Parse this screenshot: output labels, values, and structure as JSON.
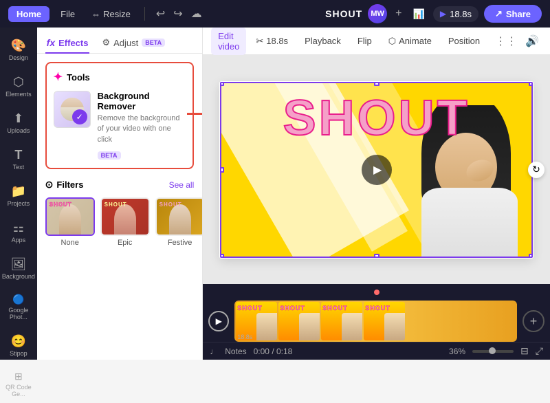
{
  "app": {
    "title": "SHOUT",
    "tab_home": "Home",
    "tab_file": "File",
    "tab_resize": "Resize",
    "share_label": "Share",
    "avatar_initials": "MW",
    "time": "18.8s"
  },
  "toolbar": {
    "edit_video": "Edit video",
    "cut_time": "18.8s",
    "playback": "Playback",
    "flip": "Flip",
    "animate": "Animate",
    "position": "Position"
  },
  "sidebar": {
    "items": [
      {
        "label": "Design",
        "icon": "🎨"
      },
      {
        "label": "Elements",
        "icon": "⬡"
      },
      {
        "label": "Uploads",
        "icon": "⬆"
      },
      {
        "label": "Text",
        "icon": "T"
      },
      {
        "label": "Projects",
        "icon": "📁"
      },
      {
        "label": "Apps",
        "icon": "⚏"
      },
      {
        "label": "Background",
        "icon": "🖼"
      },
      {
        "label": "Google Phot...",
        "icon": "🔵"
      },
      {
        "label": "Stipop",
        "icon": "😊"
      },
      {
        "label": "QR Code Ge...",
        "icon": "⊞"
      }
    ]
  },
  "effects": {
    "tab_effects": "Effects",
    "tab_adjust": "Adjust",
    "beta_label": "BETA",
    "tools_label": "Tools",
    "bg_remover_title": "Background Remover",
    "bg_remover_desc": "Remove the background of your video with one click",
    "beta_badge": "BETA",
    "filters_label": "Filters",
    "see_all": "See all",
    "filters": [
      {
        "label": "None",
        "selected": true
      },
      {
        "label": "Epic",
        "selected": false
      },
      {
        "label": "Festive",
        "selected": false
      }
    ]
  },
  "canvas": {
    "shout_text": "SHOUT",
    "refresh_icon": "↻",
    "play_icon": "▶"
  },
  "timeline": {
    "play_icon": "▶",
    "duration": "18.8s",
    "add_icon": "+",
    "notes_label": "Notes",
    "time_display": "0:00 / 0:18",
    "zoom_level": "36%"
  }
}
